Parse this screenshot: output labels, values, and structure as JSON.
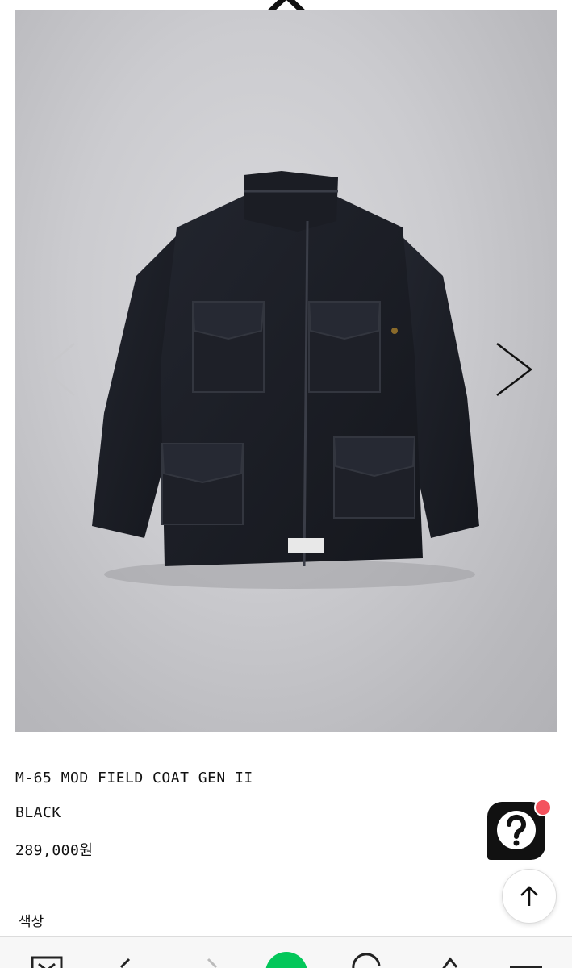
{
  "product": {
    "name": "M-65 MOD FIELD COAT GEN II",
    "color": "BLACK",
    "price": "289,000원"
  },
  "options": {
    "color_label": "색상"
  },
  "gallery": {
    "prev_icon": "chevron-left-icon",
    "next_icon": "chevron-right-icon"
  },
  "floating": {
    "help_icon": "question-chat-icon",
    "help_badge_color": "#f3535e",
    "scroll_top_icon": "arrow-up-icon"
  },
  "toolbar": {
    "items": [
      "home-icon",
      "back-icon",
      "forward-icon",
      "naver-icon",
      "refresh-icon",
      "share-icon",
      "menu-icon"
    ],
    "accent": "#03c75a"
  }
}
